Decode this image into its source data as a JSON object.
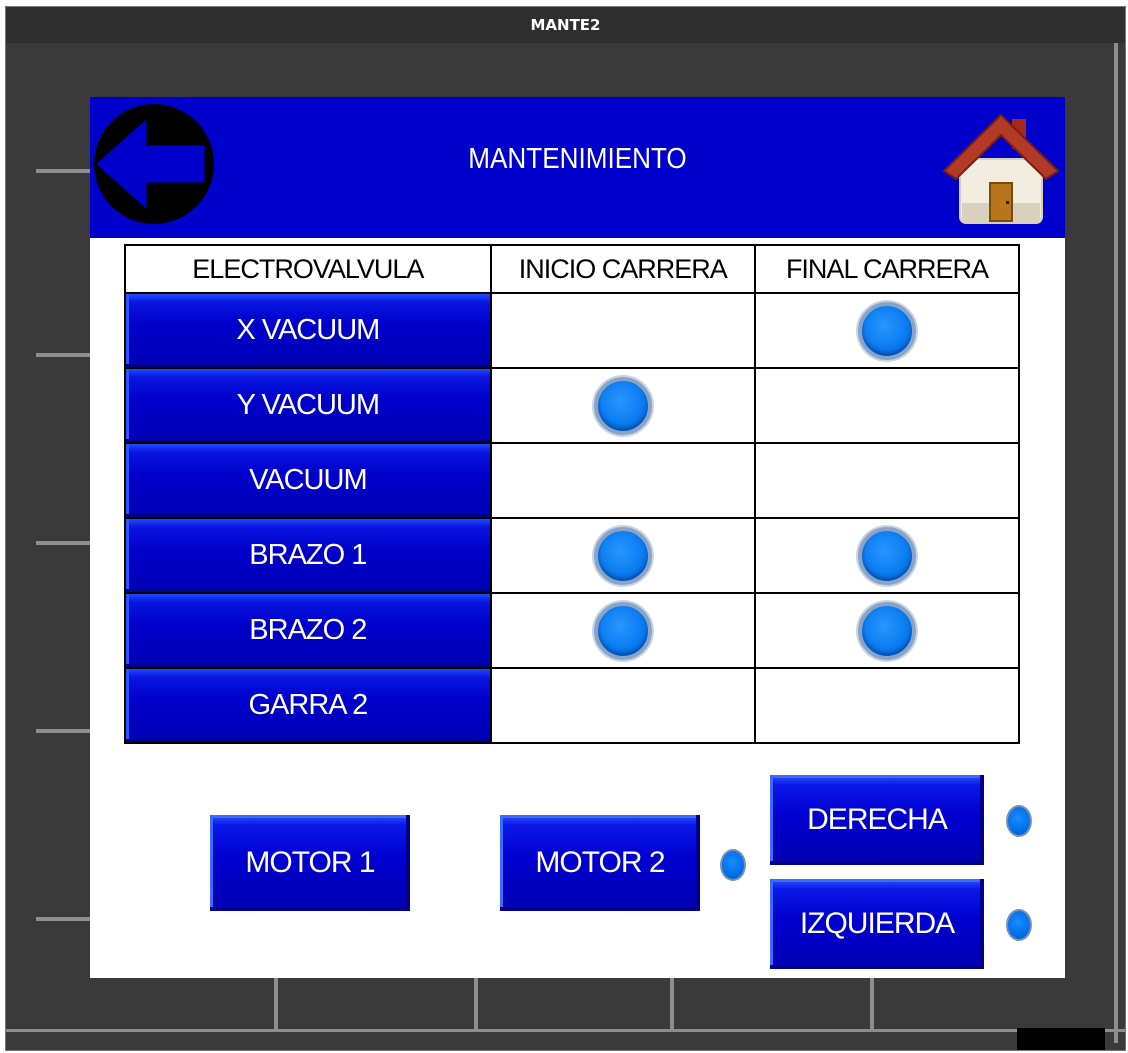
{
  "window": {
    "title": "MANTE2"
  },
  "header": {
    "title": "MANTENIMIENTO",
    "back_icon": "arrow-left-icon",
    "home_icon": "house-icon"
  },
  "table": {
    "columns": [
      "ELECTROVALVULA",
      "INICIO CARRERA",
      "FINAL CARRERA"
    ],
    "rows": [
      {
        "label": "X VACUUM",
        "inicio": false,
        "final": true
      },
      {
        "label": "Y VACUUM",
        "inicio": true,
        "final": false
      },
      {
        "label": "VACUUM",
        "inicio": false,
        "final": false
      },
      {
        "label": "BRAZO 1",
        "inicio": true,
        "final": true
      },
      {
        "label": "BRAZO 2",
        "inicio": true,
        "final": true
      },
      {
        "label": "GARRA 2",
        "inicio": false,
        "final": false
      }
    ]
  },
  "controls": {
    "motor1": "MOTOR 1",
    "motor2": "MOTOR 2",
    "derecha": "DERECHA",
    "izquierda": "IZQUIERDA"
  },
  "colors": {
    "header_blue": "#0000cc",
    "lamp_blue": "#0a7cf0",
    "frame_gray": "#3a3a3a"
  }
}
